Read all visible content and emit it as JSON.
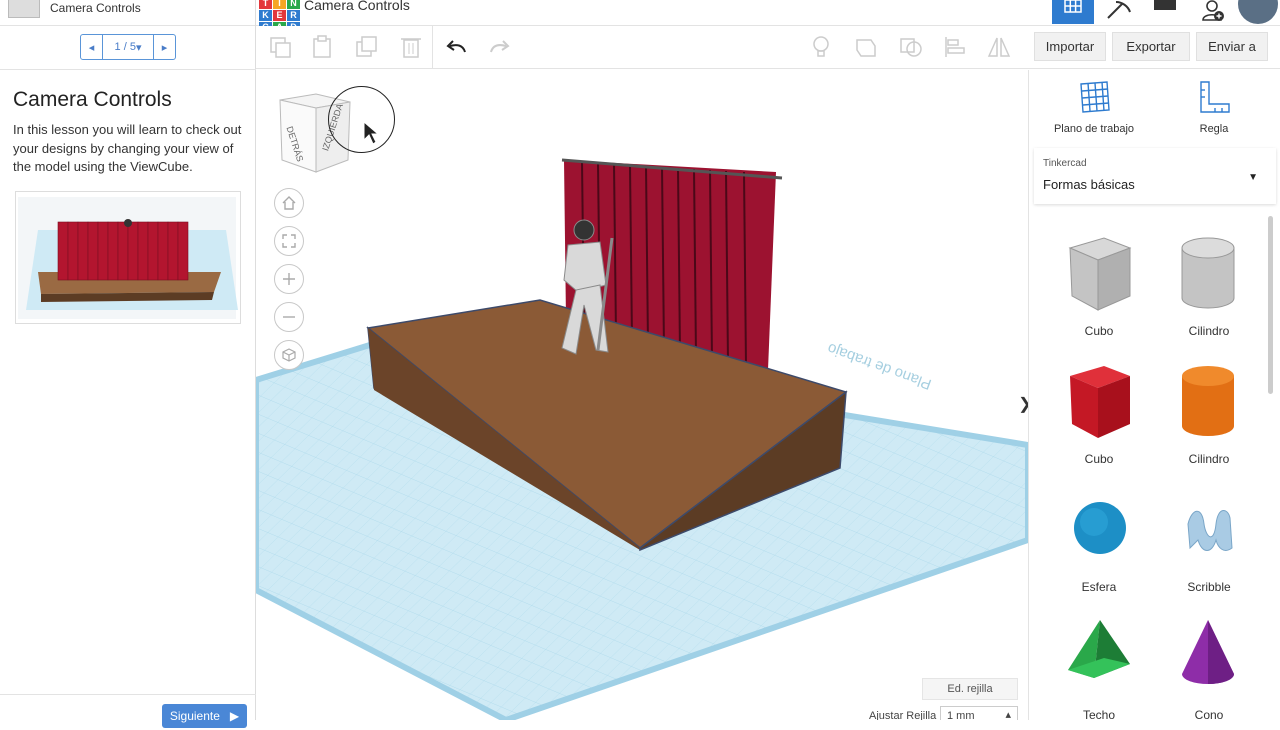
{
  "app": {
    "lesson_title": "Camera Controls",
    "project_title": "Camera Controls",
    "logo_letters": [
      "T",
      "I",
      "N",
      "K",
      "E",
      "R",
      "C",
      "A",
      "D"
    ]
  },
  "toolbar": {
    "import_label": "Importar",
    "export_label": "Exportar",
    "send_label": "Enviar a"
  },
  "lesson": {
    "pager": "1 / 5",
    "heading": "Camera Controls",
    "body": "In this lesson you will learn to check out your designs by changing your view of the model using the ViewCube.",
    "next_label": "Siguiente"
  },
  "viewcube": {
    "face_left": "DETRÁS",
    "face_right": "IZQUIERDA"
  },
  "workplane": {
    "edit_grid_label": "Ed. rejilla",
    "snap_label": "Ajustar Rejilla",
    "snap_value": "1 mm",
    "plane_text": "Plano de trabajo"
  },
  "right_panel": {
    "tool_workplane": "Plano de trabajo",
    "tool_ruler": "Regla",
    "library_provider": "Tinkercad",
    "library_name": "Formas básicas",
    "shapes": [
      {
        "label": "Cubo",
        "icon": "hole-box-icon"
      },
      {
        "label": "Cilindro",
        "icon": "hole-cylinder-icon"
      },
      {
        "label": "Cubo",
        "icon": "box-icon"
      },
      {
        "label": "Cilindro",
        "icon": "cylinder-icon"
      },
      {
        "label": "Esfera",
        "icon": "sphere-icon"
      },
      {
        "label": "Scribble",
        "icon": "scribble-icon"
      },
      {
        "label": "Techo",
        "icon": "roof-icon"
      },
      {
        "label": "Cono",
        "icon": "cone-icon"
      }
    ]
  },
  "colors": {
    "accent": "#2e7bcf",
    "grid": "#cfeaf5",
    "stage_top": "#8b5a36",
    "stage_side": "#5c3c24",
    "curtain": "#9c1230"
  }
}
